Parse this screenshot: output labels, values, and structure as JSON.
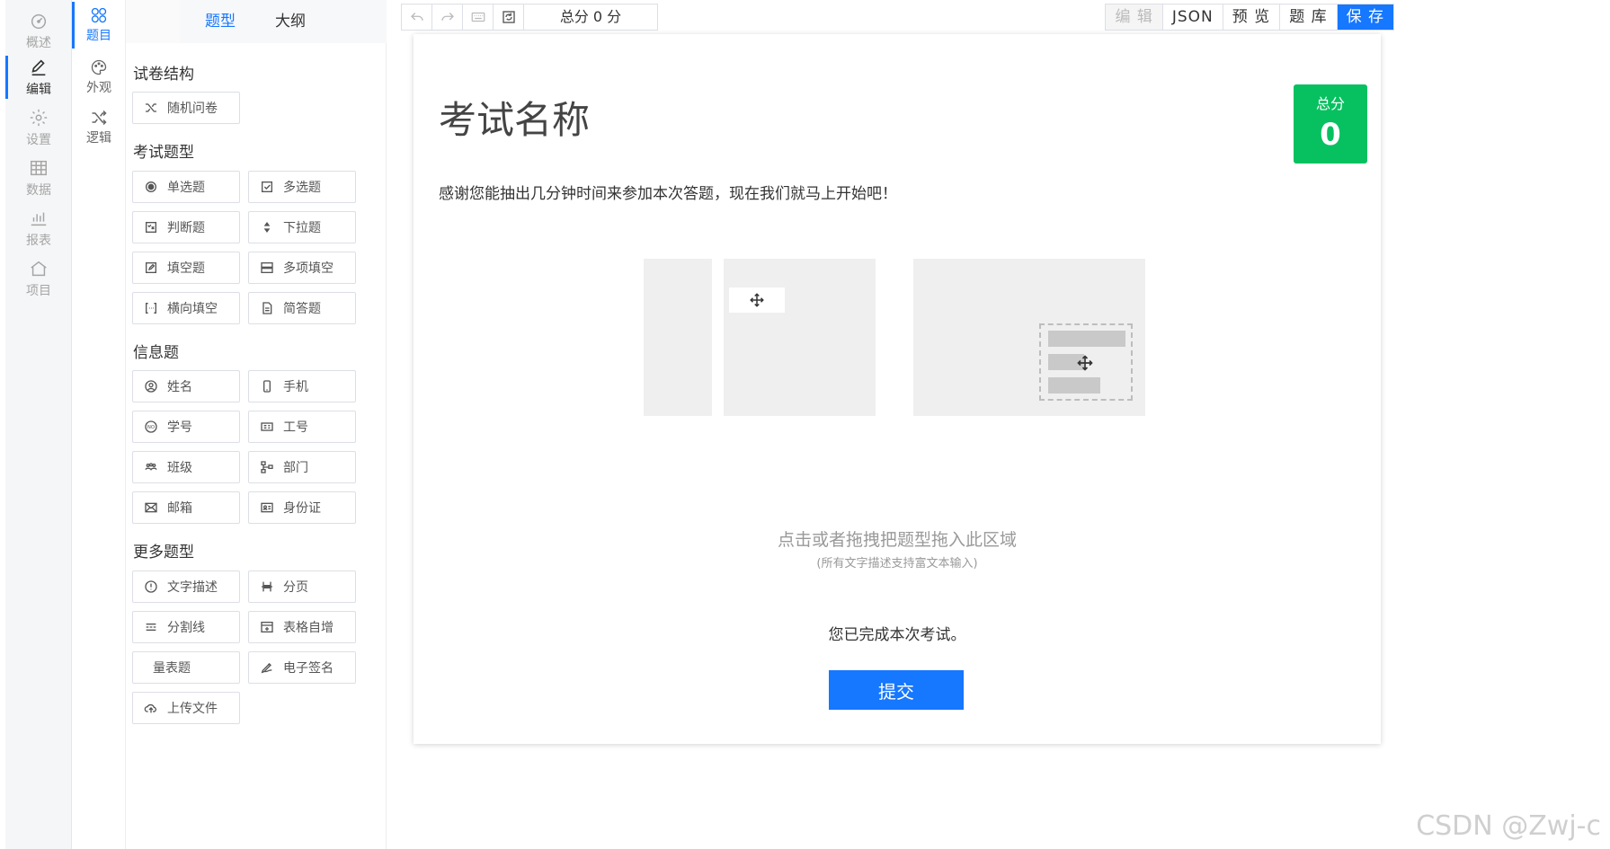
{
  "rail": {
    "items": [
      {
        "label": "概述",
        "icon": "dashboard-icon"
      },
      {
        "label": "编辑",
        "icon": "pen-icon"
      },
      {
        "label": "设置",
        "icon": "gear-icon"
      },
      {
        "label": "数据",
        "icon": "table-icon"
      },
      {
        "label": "报表",
        "icon": "bar-chart-icon"
      },
      {
        "label": "项目",
        "icon": "home-icon"
      }
    ],
    "active": "编辑"
  },
  "rail2": {
    "items": [
      {
        "label": "题目",
        "icon": "shapes-icon"
      },
      {
        "label": "外观",
        "icon": "palette-icon"
      },
      {
        "label": "逻辑",
        "icon": "shuffle-icon"
      }
    ],
    "active": "题目"
  },
  "panel": {
    "tabs": [
      "题型",
      "大纲"
    ],
    "active_tab": "题型",
    "sections": {
      "structure": {
        "title": "试卷结构",
        "items": [
          "随机问卷"
        ]
      },
      "exam": {
        "title": "考试题型",
        "items": [
          "单选题",
          "多选题",
          "判断题",
          "下拉题",
          "填空题",
          "多项填空",
          "横向填空",
          "简答题"
        ]
      },
      "info": {
        "title": "信息题",
        "items": [
          "姓名",
          "手机",
          "学号",
          "工号",
          "班级",
          "部门",
          "邮箱",
          "身份证"
        ]
      },
      "more": {
        "title": "更多题型",
        "items": [
          "文字描述",
          "分页",
          "分割线",
          "表格自增",
          "量表题",
          "电子签名",
          "上传文件"
        ]
      }
    }
  },
  "toolbar": {
    "score_text": "总分 0 分",
    "buttons": [
      "编 辑",
      "JSON",
      "预 览",
      "题 库",
      "保 存"
    ]
  },
  "paper": {
    "title": "考试名称",
    "score_label": "总分",
    "score_value": "0",
    "intro": "感谢您能抽出几分钟时间来参加本次答题，现在我们就马上开始吧！",
    "drop_hint": "点击或者拖拽把题型拖入此区域",
    "drop_sub": "(所有文字描述支持富文本输入)",
    "done_text": "您已完成本次考试。",
    "submit_label": "提交"
  },
  "colors": {
    "accent": "#1677ff",
    "score_green": "#07c160"
  },
  "watermark": "CSDN @Zwj-c"
}
